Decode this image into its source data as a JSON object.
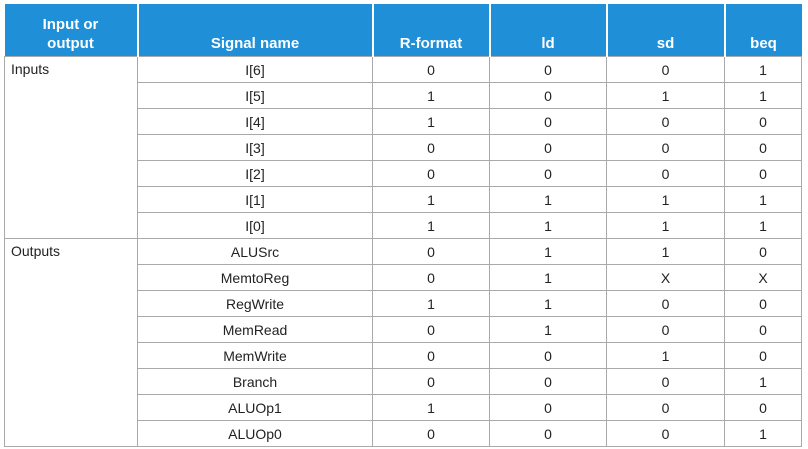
{
  "header": {
    "group": "Input or output",
    "signal": "Signal name",
    "cols": [
      "R-format",
      "ld",
      "sd",
      "beq"
    ]
  },
  "groups": [
    {
      "label": "Inputs",
      "rows": [
        {
          "signal": "I[6]",
          "values": [
            "0",
            "0",
            "0",
            "1"
          ]
        },
        {
          "signal": "I[5]",
          "values": [
            "1",
            "0",
            "1",
            "1"
          ]
        },
        {
          "signal": "I[4]",
          "values": [
            "1",
            "0",
            "0",
            "0"
          ]
        },
        {
          "signal": "I[3]",
          "values": [
            "0",
            "0",
            "0",
            "0"
          ]
        },
        {
          "signal": "I[2]",
          "values": [
            "0",
            "0",
            "0",
            "0"
          ]
        },
        {
          "signal": "I[1]",
          "values": [
            "1",
            "1",
            "1",
            "1"
          ]
        },
        {
          "signal": "I[0]",
          "values": [
            "1",
            "1",
            "1",
            "1"
          ]
        }
      ]
    },
    {
      "label": "Outputs",
      "rows": [
        {
          "signal": "ALUSrc",
          "values": [
            "0",
            "1",
            "1",
            "0"
          ]
        },
        {
          "signal": "MemtoReg",
          "values": [
            "0",
            "1",
            "X",
            "X"
          ]
        },
        {
          "signal": "RegWrite",
          "values": [
            "1",
            "1",
            "0",
            "0"
          ]
        },
        {
          "signal": "MemRead",
          "values": [
            "0",
            "1",
            "0",
            "0"
          ]
        },
        {
          "signal": "MemWrite",
          "values": [
            "0",
            "0",
            "1",
            "0"
          ]
        },
        {
          "signal": "Branch",
          "values": [
            "0",
            "0",
            "0",
            "1"
          ]
        },
        {
          "signal": "ALUOp1",
          "values": [
            "1",
            "0",
            "0",
            "0"
          ]
        },
        {
          "signal": "ALUOp0",
          "values": [
            "0",
            "0",
            "0",
            "1"
          ]
        }
      ]
    }
  ],
  "colors": {
    "header_bg": "#1f8fd8",
    "header_text": "#ffffff",
    "grid": "#a9a9a9"
  }
}
